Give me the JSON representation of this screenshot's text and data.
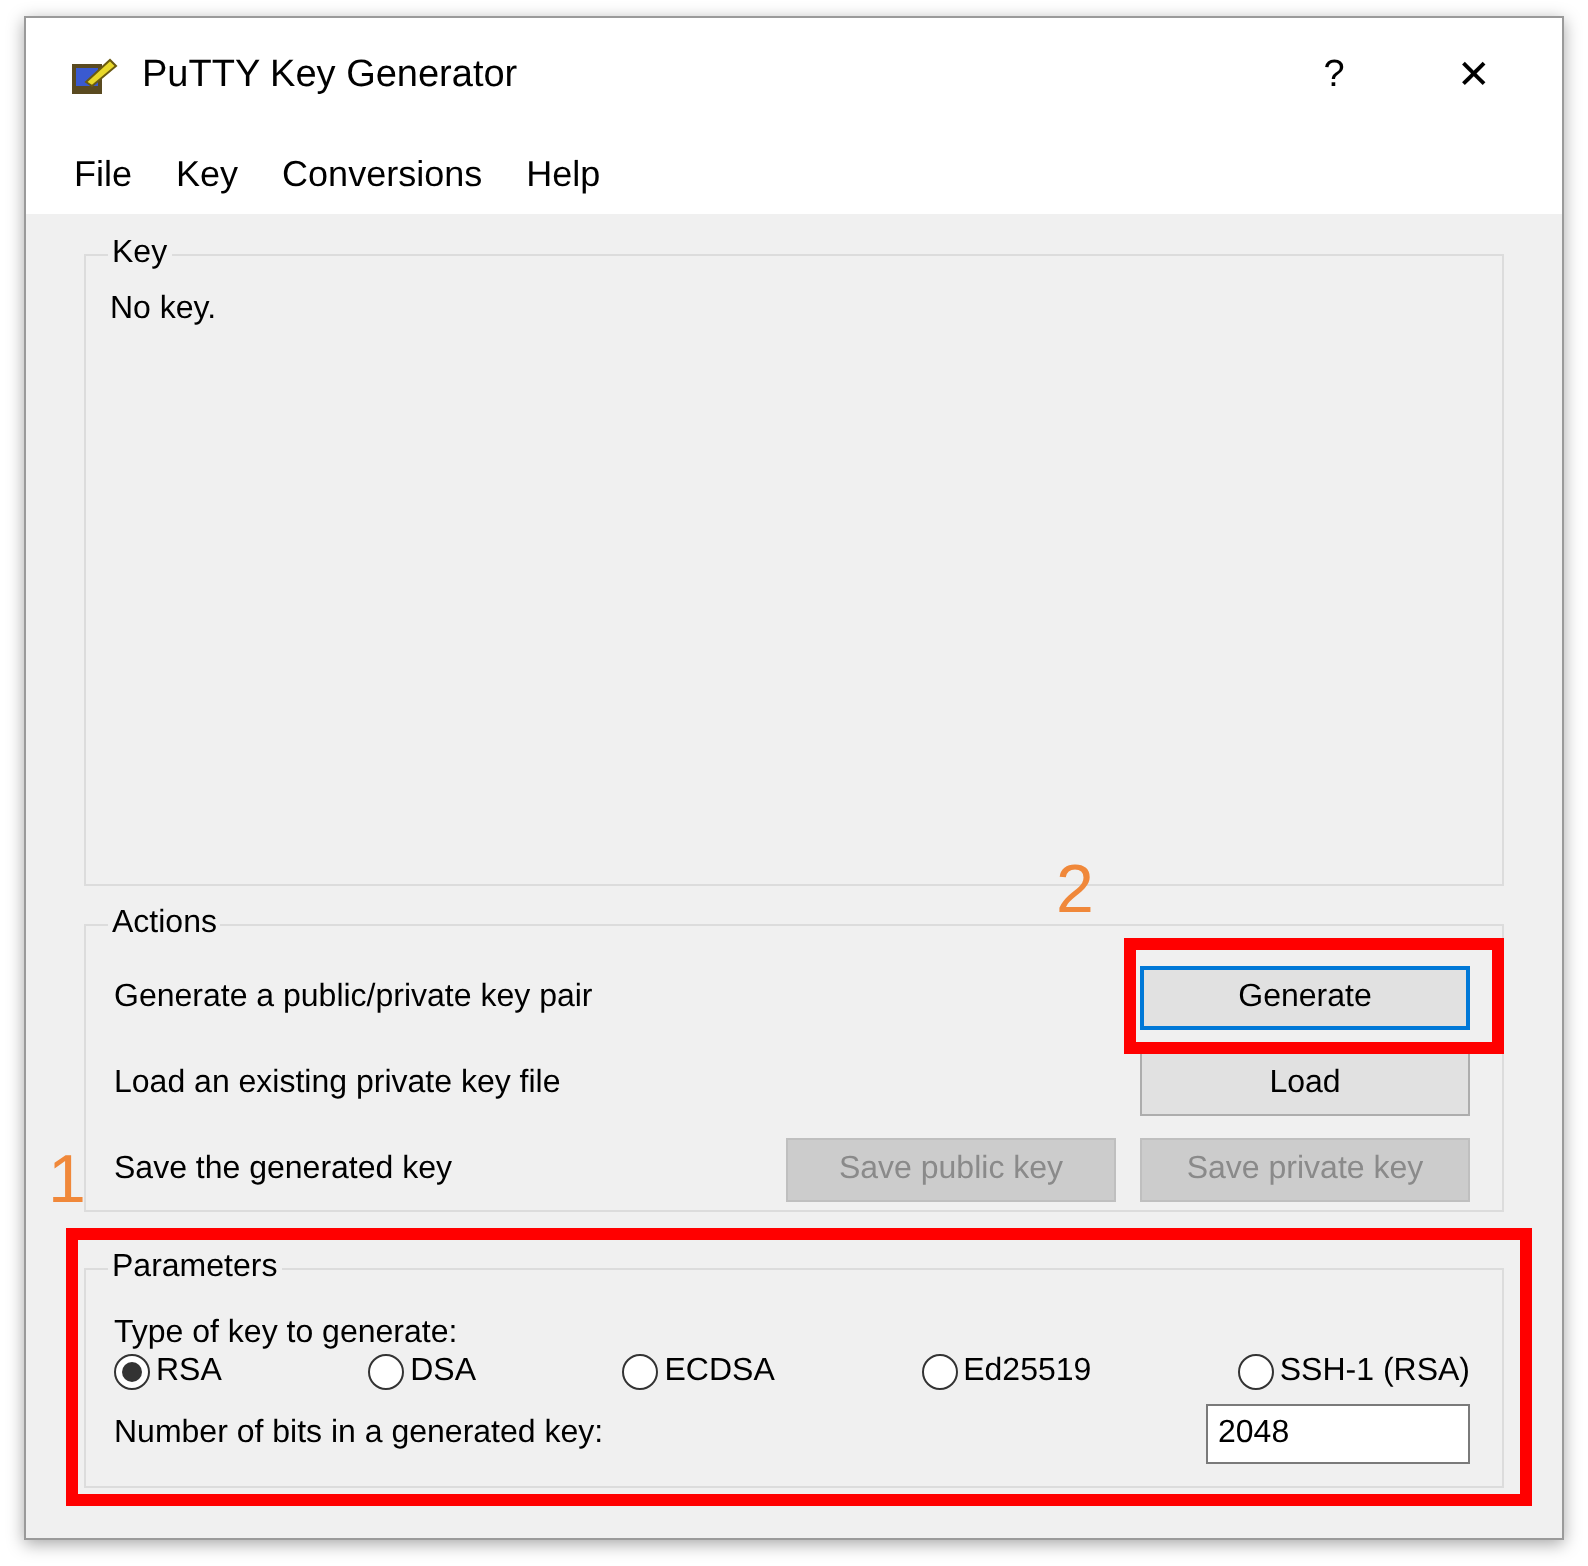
{
  "window": {
    "title": "PuTTY Key Generator",
    "help_button": "?",
    "close_button": "✕"
  },
  "menu": [
    "File",
    "Key",
    "Conversions",
    "Help"
  ],
  "key_group": {
    "label": "Key",
    "text": "No key."
  },
  "actions": {
    "label": "Actions",
    "rows": [
      {
        "text": "Generate a public/private key pair",
        "buttons": [
          {
            "label": "Generate",
            "disabled": false,
            "focused": true
          }
        ]
      },
      {
        "text": "Load an existing private key file",
        "buttons": [
          {
            "label": "Load",
            "disabled": false,
            "focused": false
          }
        ]
      },
      {
        "text": "Save the generated key",
        "buttons": [
          {
            "label": "Save public key",
            "disabled": true,
            "focused": false
          },
          {
            "label": "Save private key",
            "disabled": true,
            "focused": false
          }
        ]
      }
    ]
  },
  "parameters": {
    "label": "Parameters",
    "type_label": "Type of key to generate:",
    "key_types": [
      {
        "label": "RSA",
        "selected": true
      },
      {
        "label": "DSA",
        "selected": false
      },
      {
        "label": "ECDSA",
        "selected": false
      },
      {
        "label": "Ed25519",
        "selected": false
      },
      {
        "label": "SSH-1 (RSA)",
        "selected": false
      }
    ],
    "bits_label": "Number of bits in a generated key:",
    "bits_value": "2048"
  },
  "annotations": [
    {
      "label": "1"
    },
    {
      "label": "2"
    }
  ]
}
